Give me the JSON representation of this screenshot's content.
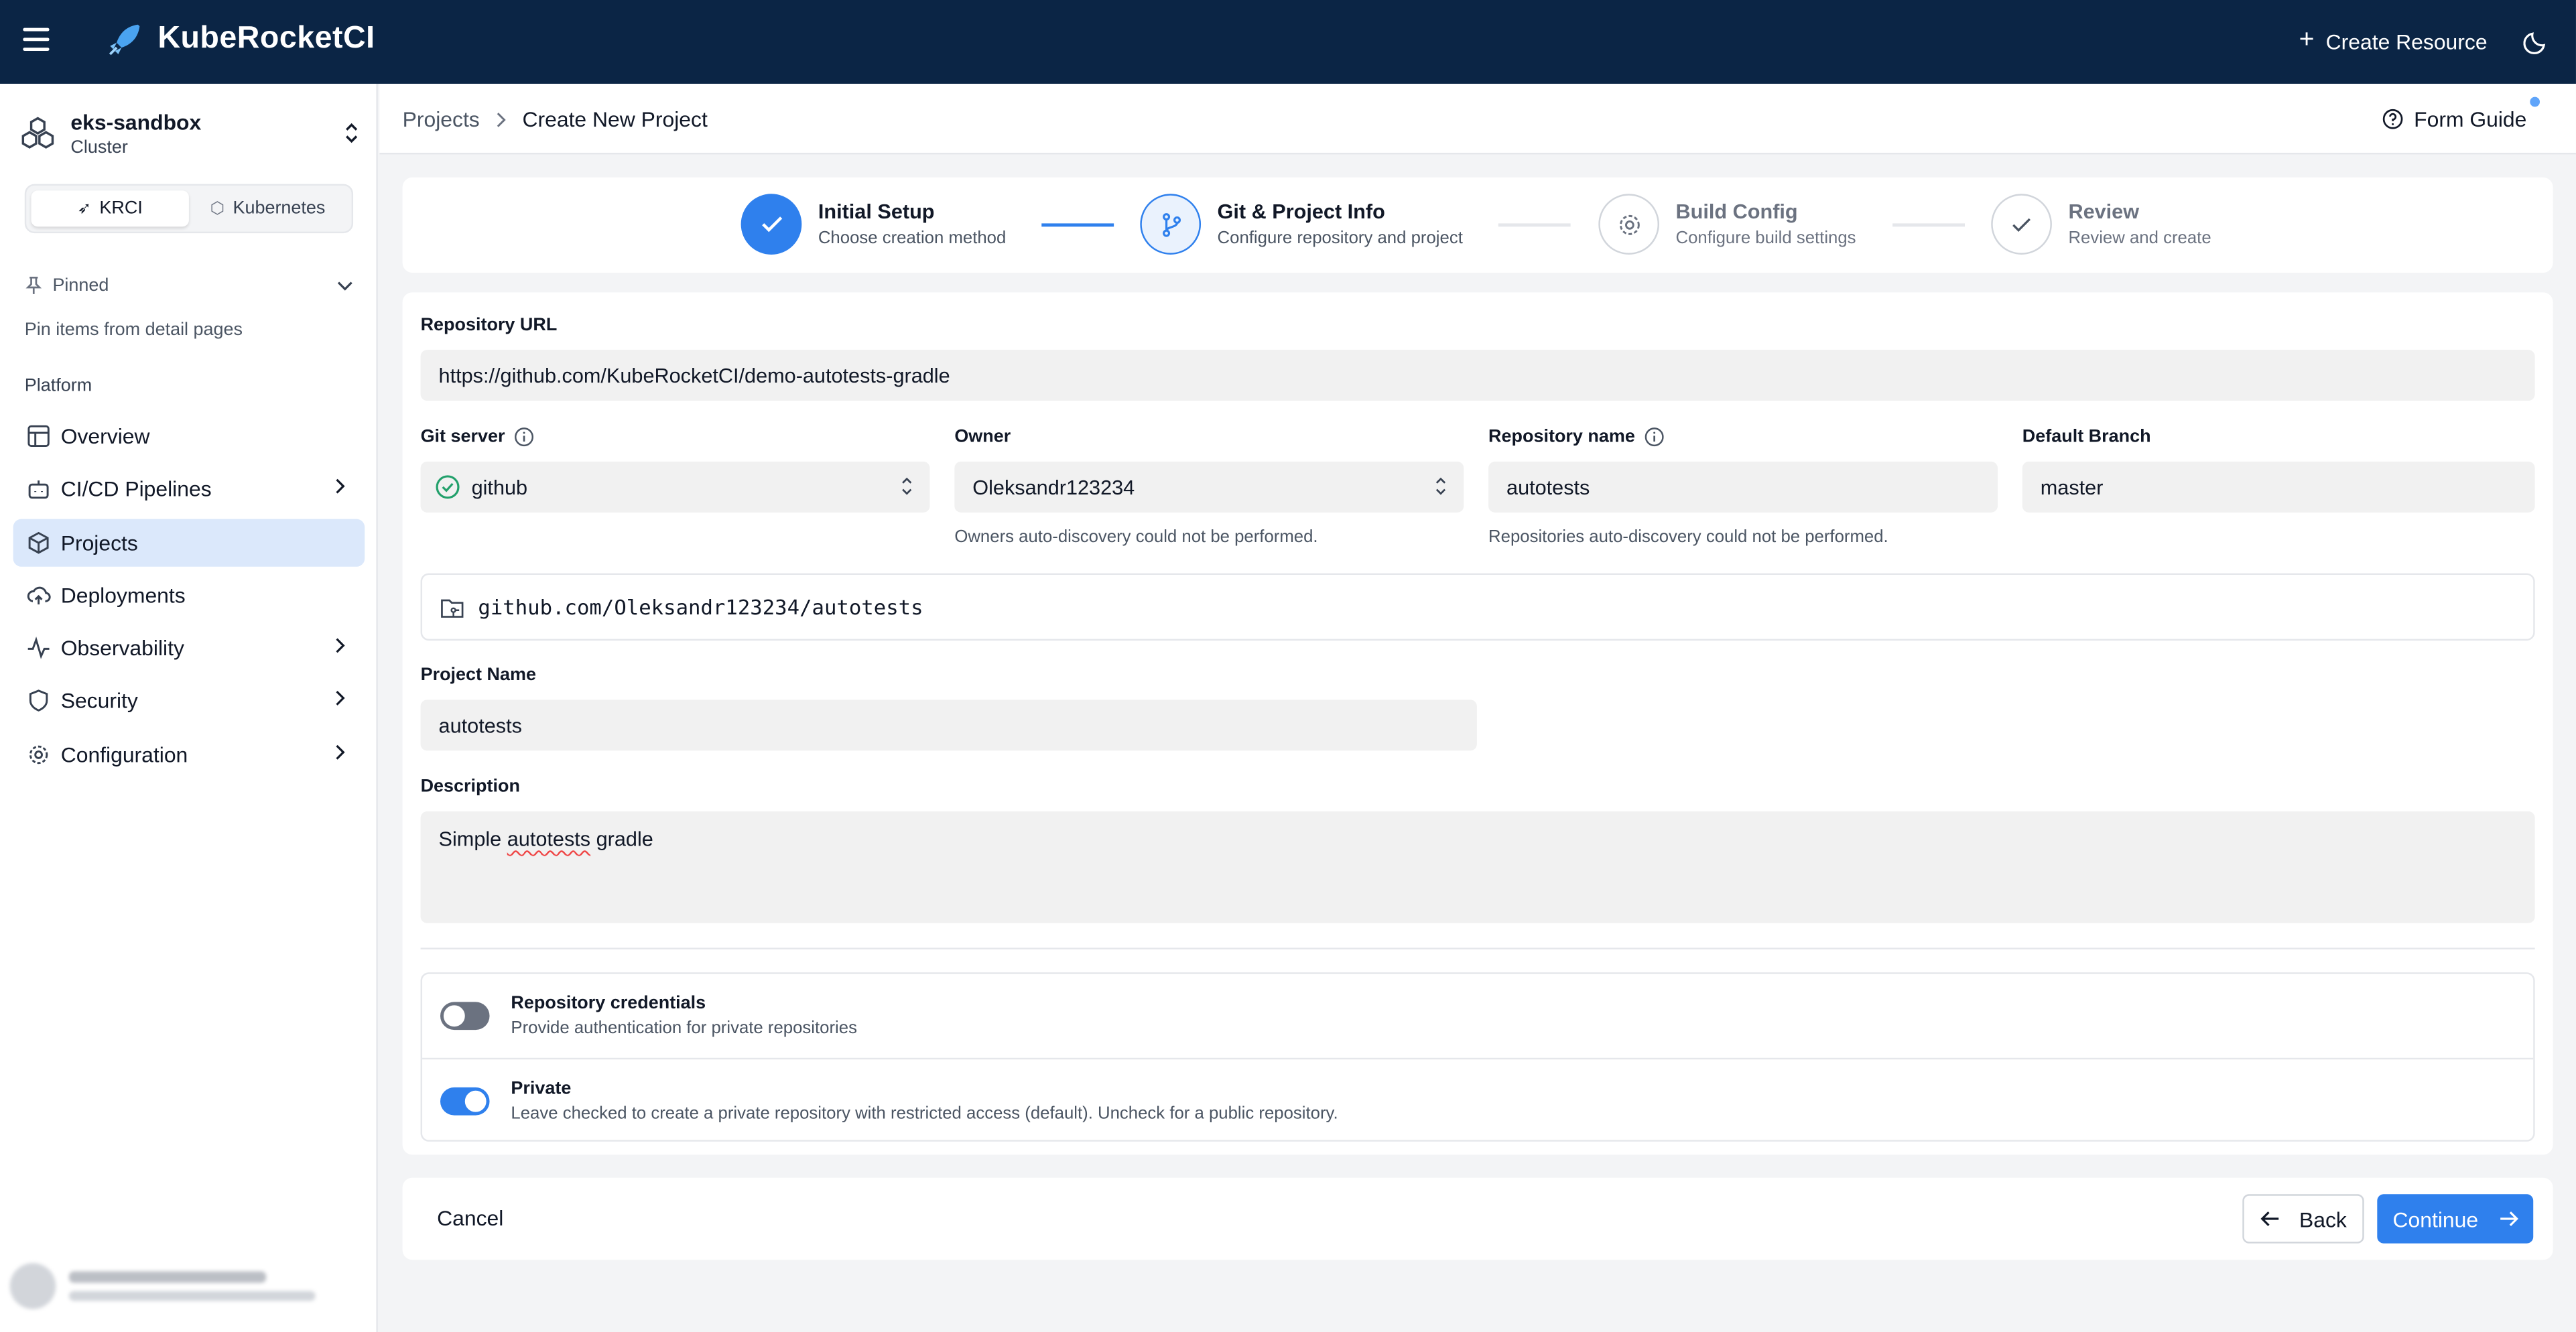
{
  "app": {
    "brand": "KubeRocketCI",
    "create_resource": "Create Resource"
  },
  "sidebar": {
    "cluster_name": "eks-sandbox",
    "cluster_type": "Cluster",
    "segments": [
      "KRCI",
      "Kubernetes"
    ],
    "pinned_label": "Pinned",
    "pinned_hint": "Pin items from detail pages",
    "section": "Platform",
    "items": [
      {
        "label": "Overview",
        "icon": "layout-icon"
      },
      {
        "label": "CI/CD Pipelines",
        "icon": "bot-icon"
      },
      {
        "label": "Projects",
        "icon": "box-icon"
      },
      {
        "label": "Deployments",
        "icon": "cloud-upload-icon"
      },
      {
        "label": "Observability",
        "icon": "activity-icon"
      },
      {
        "label": "Security",
        "icon": "shield-icon"
      },
      {
        "label": "Configuration",
        "icon": "gear-icon"
      }
    ]
  },
  "breadcrumb": {
    "parent": "Projects",
    "current": "Create New Project"
  },
  "form_guide": "Form Guide",
  "steps": [
    {
      "title": "Initial Setup",
      "subtitle": "Choose creation method"
    },
    {
      "title": "Git & Project Info",
      "subtitle": "Configure repository and project"
    },
    {
      "title": "Build Config",
      "subtitle": "Configure build settings"
    },
    {
      "title": "Review",
      "subtitle": "Review and create"
    }
  ],
  "form": {
    "repo_url_label": "Repository URL",
    "repo_url": "https://github.com/KubeRocketCI/demo-autotests-gradle",
    "git_server_label": "Git server",
    "git_server": "github",
    "owner_label": "Owner",
    "owner": "Oleksandr123234",
    "owner_help": "Owners auto-discovery could not be performed.",
    "repo_name_label": "Repository name",
    "repo_name": "autotests",
    "repo_help": "Repositories auto-discovery could not be performed.",
    "branch_label": "Default Branch",
    "branch": "master",
    "repo_path": "github.com/Oleksandr123234/autotests",
    "project_name_label": "Project Name",
    "project_name": "autotests",
    "description_label": "Description",
    "description_a": "Simple ",
    "description_b": "autotests",
    "description_c": " gradle",
    "cred_title": "Repository credentials",
    "cred_desc": "Provide authentication for private repositories",
    "private_title": "Private",
    "private_desc": "Leave checked to create a private repository with restricted access (default). Uncheck for a public repository."
  },
  "footer": {
    "cancel": "Cancel",
    "back": "Back",
    "continue": "Continue"
  },
  "colors": {
    "topbar": "#0b2545",
    "accent": "#2f80ed",
    "success": "#22a06b"
  }
}
